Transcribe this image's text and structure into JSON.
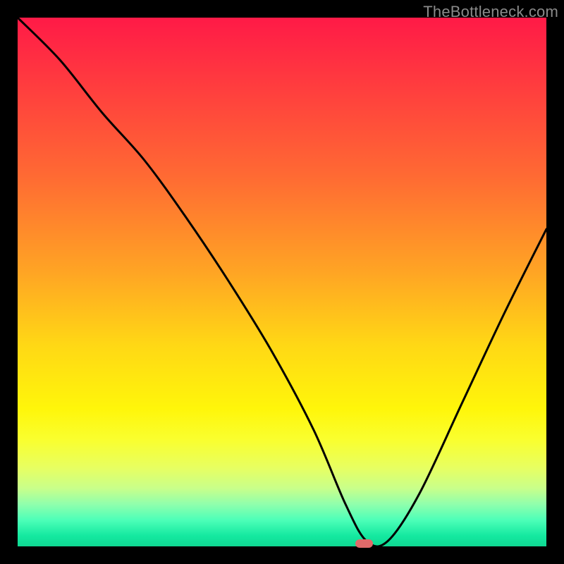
{
  "watermark": "TheBottleneck.com",
  "marker": {
    "x_norm": 0.655,
    "y_norm": 0.996,
    "color": "#e06a6a"
  },
  "chart_data": {
    "type": "line",
    "title": "",
    "xlabel": "",
    "ylabel": "",
    "xlim": [
      0,
      1
    ],
    "ylim": [
      0,
      1
    ],
    "series": [
      {
        "name": "curve",
        "x": [
          0.0,
          0.08,
          0.16,
          0.24,
          0.32,
          0.4,
          0.48,
          0.56,
          0.62,
          0.66,
          0.7,
          0.76,
          0.84,
          0.92,
          1.0
        ],
        "y": [
          1.0,
          0.92,
          0.82,
          0.73,
          0.62,
          0.5,
          0.37,
          0.22,
          0.08,
          0.01,
          0.01,
          0.1,
          0.27,
          0.44,
          0.6
        ]
      }
    ],
    "gradient_stops": [
      {
        "pos": 0.0,
        "color": "#ff1a47"
      },
      {
        "pos": 0.3,
        "color": "#ff6a33"
      },
      {
        "pos": 0.62,
        "color": "#ffd815"
      },
      {
        "pos": 0.85,
        "color": "#e8ff60"
      },
      {
        "pos": 1.0,
        "color": "#0fd892"
      }
    ]
  }
}
